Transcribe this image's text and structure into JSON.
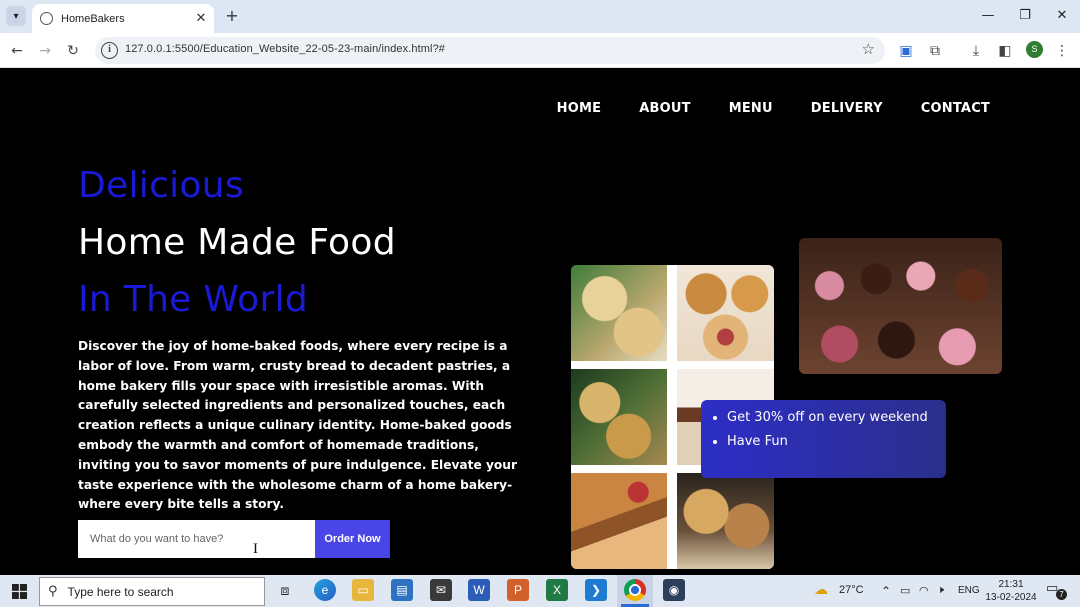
{
  "browser": {
    "tab_title": "HomeBakers",
    "new_tab": "+",
    "url": "127.0.0.1:5500/Education_Website_22-05-23-main/index.html?#",
    "profile_initial": "S"
  },
  "page": {
    "nav": [
      "HOME",
      "ABOUT",
      "MENU",
      "DELIVERY",
      "CONTACT"
    ],
    "hero": {
      "line1": "Delicious",
      "line2": "Home Made Food",
      "line3": "In The World",
      "description": "Discover the joy of home-baked foods, where every recipe is a labor of love. From warm, crusty bread to decadent pastries, a home bakery fills your space with irresistible aromas. With carefully selected ingredients and personalized touches, each creation reflects a unique culinary identity. Home-baked goods embody the warmth and comfort of homemade traditions, inviting you to savor moments of pure indulgence. Elevate your taste experience with the wholesome charm of a home bakery-where every bite tells a story."
    },
    "search": {
      "placeholder": "What do you want to have?",
      "value": "",
      "button": "Order Now"
    },
    "promo": [
      "Get 30% off on every weekend",
      "Have Fun"
    ],
    "colors": {
      "accent": "#1a1ad6",
      "button": "#4a45e6",
      "promo_bg": "#2d2ec6"
    }
  },
  "taskbar": {
    "search_placeholder": "Type here to search",
    "weather": "27°C",
    "language": "ENG",
    "time": "21:31",
    "date": "13-02-2024",
    "notifications": "7"
  }
}
